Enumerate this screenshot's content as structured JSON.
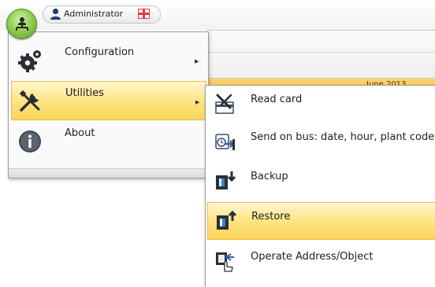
{
  "header": {
    "user_name": "Administrator",
    "user_icon": "user-icon",
    "language_icon": "uk-flag-icon"
  },
  "calendar": {
    "month_label": "June 2013"
  },
  "main_menu": {
    "items": [
      {
        "label": "Configuration",
        "icon": "gears-icon",
        "has_submenu": true
      },
      {
        "label": "Utilities",
        "icon": "tools-icon",
        "has_submenu": true,
        "selected": true
      },
      {
        "label": "About",
        "icon": "info-icon",
        "has_submenu": false
      }
    ]
  },
  "utilities_menu": {
    "items": [
      {
        "label": "Read card",
        "icon": "read-card-icon"
      },
      {
        "label": "Send on bus: date, hour, plant code",
        "icon": "send-on-bus-icon"
      },
      {
        "label": "Backup",
        "icon": "backup-icon"
      },
      {
        "label": "Restore",
        "icon": "restore-icon",
        "selected": true
      },
      {
        "label": "Operate Address/Object",
        "icon": "operate-address-icon"
      }
    ]
  },
  "colors": {
    "highlight_top": "#fff7cf",
    "highlight_bottom": "#fbd55a",
    "highlight_border": "#e7b94b",
    "orb_green": "#8ccb4e"
  }
}
